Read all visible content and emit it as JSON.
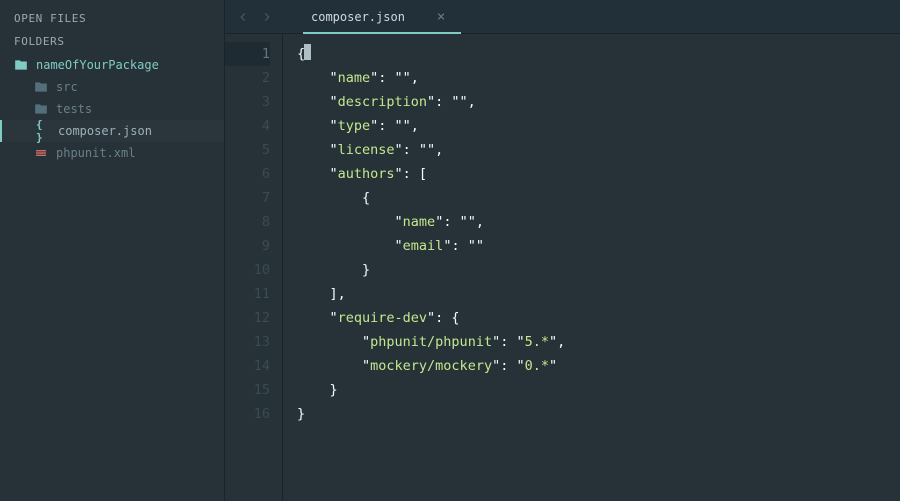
{
  "sidebar": {
    "sections": {
      "openFiles": "OPEN FILES",
      "folders": "FOLDERS"
    },
    "root": "nameOfYourPackage",
    "items": [
      {
        "name": "src",
        "type": "folder"
      },
      {
        "name": "tests",
        "type": "folder"
      },
      {
        "name": "composer.json",
        "type": "json",
        "active": true
      },
      {
        "name": "phpunit.xml",
        "type": "xml"
      }
    ]
  },
  "tab": {
    "title": "composer.json"
  },
  "editor": {
    "language": "json",
    "lines": [
      [
        {
          "t": "p",
          "v": "{"
        }
      ],
      [
        {
          "t": "p",
          "v": "    \""
        },
        {
          "t": "k",
          "v": "name"
        },
        {
          "t": "p",
          "v": "\": \"\","
        }
      ],
      [
        {
          "t": "p",
          "v": "    \""
        },
        {
          "t": "k",
          "v": "description"
        },
        {
          "t": "p",
          "v": "\": \"\","
        }
      ],
      [
        {
          "t": "p",
          "v": "    \""
        },
        {
          "t": "k",
          "v": "type"
        },
        {
          "t": "p",
          "v": "\": \"\","
        }
      ],
      [
        {
          "t": "p",
          "v": "    \""
        },
        {
          "t": "k",
          "v": "license"
        },
        {
          "t": "p",
          "v": "\": \"\","
        }
      ],
      [
        {
          "t": "p",
          "v": "    \""
        },
        {
          "t": "k",
          "v": "authors"
        },
        {
          "t": "p",
          "v": "\": ["
        }
      ],
      [
        {
          "t": "p",
          "v": "        {"
        }
      ],
      [
        {
          "t": "p",
          "v": "            \""
        },
        {
          "t": "k",
          "v": "name"
        },
        {
          "t": "p",
          "v": "\": \"\","
        }
      ],
      [
        {
          "t": "p",
          "v": "            \""
        },
        {
          "t": "k",
          "v": "email"
        },
        {
          "t": "p",
          "v": "\": \"\""
        }
      ],
      [
        {
          "t": "p",
          "v": "        }"
        }
      ],
      [
        {
          "t": "p",
          "v": "    ],"
        }
      ],
      [
        {
          "t": "p",
          "v": "    \""
        },
        {
          "t": "k",
          "v": "require-dev"
        },
        {
          "t": "p",
          "v": "\": {"
        }
      ],
      [
        {
          "t": "p",
          "v": "        \""
        },
        {
          "t": "k",
          "v": "phpunit/phpunit"
        },
        {
          "t": "p",
          "v": "\": \""
        },
        {
          "t": "s",
          "v": "5.*"
        },
        {
          "t": "p",
          "v": "\","
        }
      ],
      [
        {
          "t": "p",
          "v": "        \""
        },
        {
          "t": "k",
          "v": "mockery/mockery"
        },
        {
          "t": "p",
          "v": "\": \""
        },
        {
          "t": "s",
          "v": "0.*"
        },
        {
          "t": "p",
          "v": "\""
        }
      ],
      [
        {
          "t": "p",
          "v": "    }"
        }
      ],
      [
        {
          "t": "p",
          "v": "}"
        }
      ]
    ],
    "currentLine": 1,
    "content": {
      "name": "",
      "description": "",
      "type": "",
      "license": "",
      "authors": [
        {
          "name": "",
          "email": ""
        }
      ],
      "require-dev": {
        "phpunit/phpunit": "5.*",
        "mockery/mockery": "0.*"
      }
    }
  }
}
